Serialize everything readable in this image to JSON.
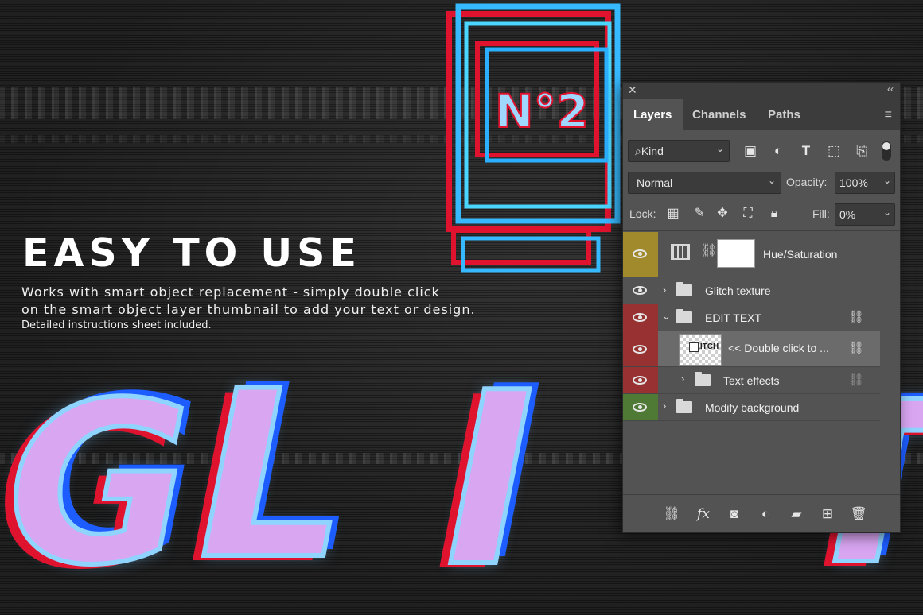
{
  "hero": {
    "headline": "EASY TO USE",
    "line1": "Works with smart object replacement - simply double click",
    "line2": "on the smart object layer thumbnail to add your text or design.",
    "line3": "Detailed instructions sheet included."
  },
  "art": {
    "letters": [
      "G",
      "L",
      "I",
      "T"
    ],
    "monitor_text": "N°2"
  },
  "panel": {
    "close": "✕",
    "collapse": "‹‹",
    "tabs": [
      {
        "label": "Layers",
        "active": true
      },
      {
        "label": "Channels",
        "active": false
      },
      {
        "label": "Paths",
        "active": false
      }
    ],
    "menu_icon": "≡",
    "filter": {
      "kind_label": "Kind",
      "search_icon": "⌕"
    },
    "blend": {
      "mode": "Normal",
      "opacity_label": "Opacity:",
      "opacity_value": "100%"
    },
    "lock": {
      "label": "Lock:",
      "fill_label": "Fill:",
      "fill_value": "0%"
    },
    "layers": [
      {
        "name": "Hue/Saturation",
        "eye_color": "#a08a2c",
        "kind": "adjustment",
        "link": false
      },
      {
        "name": "Glitch texture",
        "eye_color": "#535353",
        "kind": "group",
        "expanded": false,
        "indent": 0,
        "link": false
      },
      {
        "name": "EDIT TEXT",
        "eye_color": "#983232",
        "kind": "group",
        "expanded": true,
        "indent": 0,
        "link": true
      },
      {
        "name": "<< Double click to ...",
        "eye_color": "#983232",
        "kind": "smart-object",
        "selected": true,
        "link": true,
        "thumb_text": "GLITCH"
      },
      {
        "name": "Text effects",
        "eye_color": "#983232",
        "kind": "group",
        "expanded": false,
        "indent": 1,
        "link": true
      },
      {
        "name": "Modify background",
        "eye_color": "#4e7a36",
        "kind": "group",
        "expanded": false,
        "indent": 0,
        "link": false
      }
    ]
  }
}
